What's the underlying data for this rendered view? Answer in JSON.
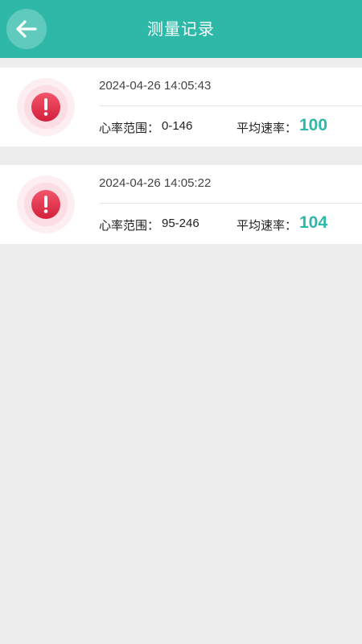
{
  "header": {
    "title": "测量记录",
    "back_icon": "arrow-left-icon",
    "background_color": "#2db8a8"
  },
  "records": [
    {
      "time": "2024-04-26 14:05:43",
      "range_label": "心率范围：",
      "range_value": "0-146",
      "avg_label": "平均速率：",
      "avg_value": "100",
      "status_icon": "alert-exclamation-icon"
    },
    {
      "time": "2024-04-26 14:05:22",
      "range_label": "心率范围：",
      "range_value": "95-246",
      "avg_label": "平均速率：",
      "avg_value": "104",
      "status_icon": "alert-exclamation-icon"
    }
  ],
  "colors": {
    "accent": "#2db8a8",
    "alert": "#e0324d",
    "page_background": "#ededed"
  }
}
